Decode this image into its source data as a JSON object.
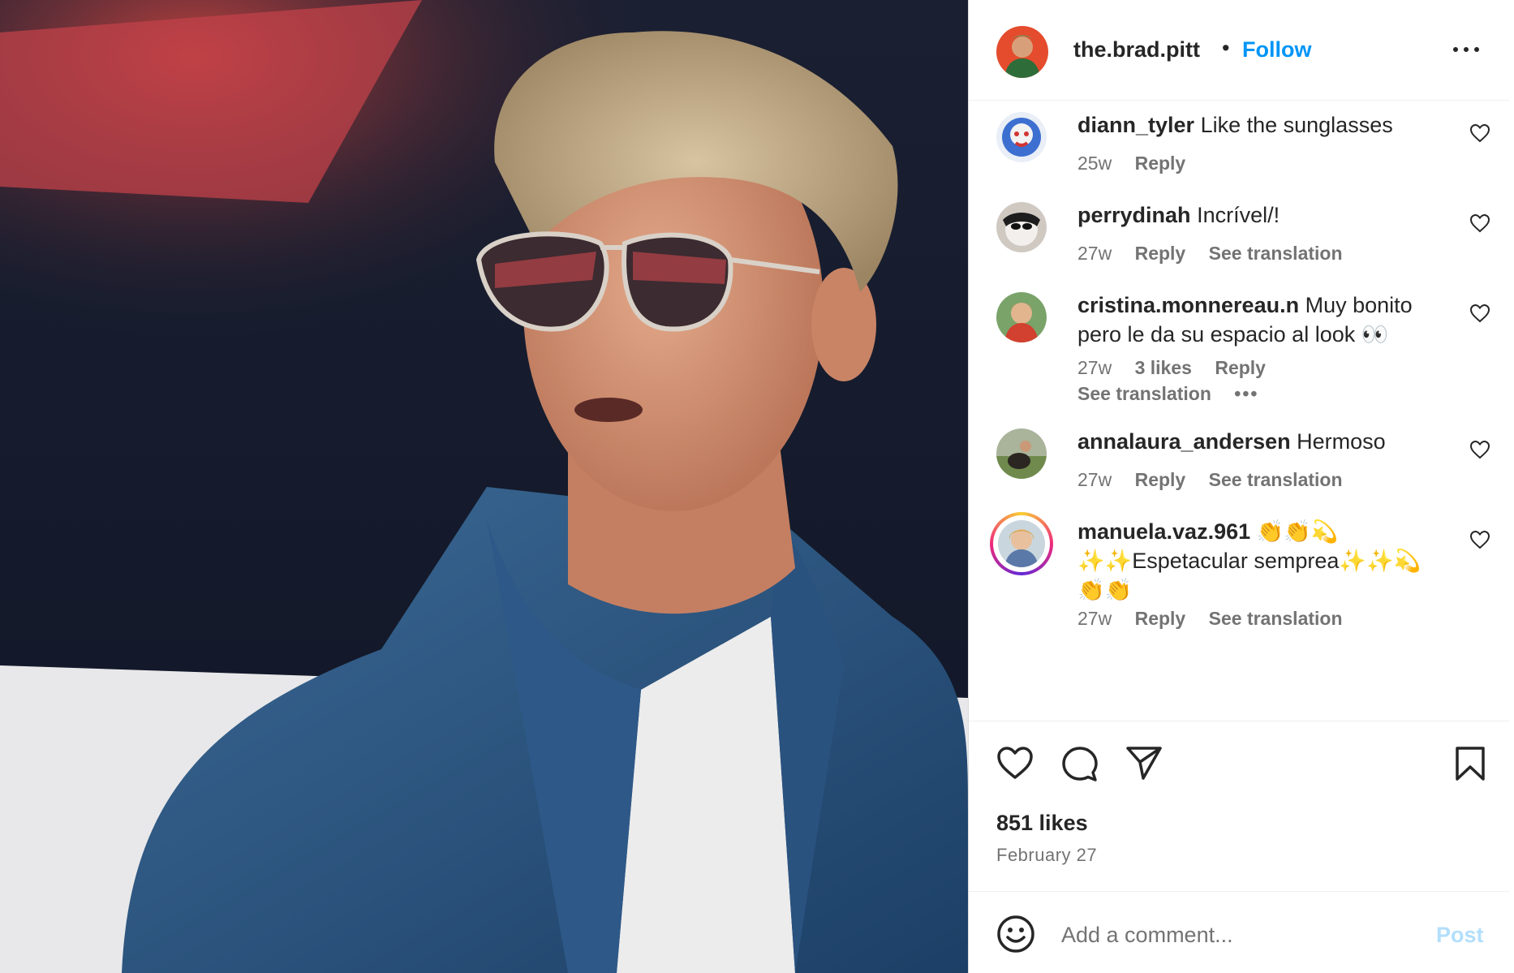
{
  "post": {
    "photo_alt": "photo",
    "author": "the.brad.pitt",
    "separator": "•",
    "follow_label": "Follow",
    "more_icon": "more-horizontal-icon"
  },
  "comments": [
    {
      "user": "diann_tyler",
      "text": "Like the sunglasses",
      "time": "25w",
      "likes": "",
      "reply": "Reply",
      "translation": "",
      "has_story_ring": false
    },
    {
      "user": "perrydinah",
      "text": "Incrível/!",
      "time": "27w",
      "likes": "",
      "reply": "Reply",
      "translation": "See translation",
      "has_story_ring": false
    },
    {
      "user": "cristina.monnereau.n",
      "text": "Muy bonito pero le da su espacio al look 👀",
      "time": "27w",
      "likes": "3 likes",
      "reply": "Reply",
      "translation": "See translation",
      "more": "•••",
      "has_story_ring": false
    },
    {
      "user": "annalaura_andersen",
      "text": "Hermoso",
      "time": "27w",
      "likes": "",
      "reply": "Reply",
      "translation": "See translation",
      "has_story_ring": false
    },
    {
      "user": "manuela.vaz.961",
      "text": "👏👏💫✨✨Espetacular semprea✨✨💫👏👏",
      "time": "27w",
      "likes": "",
      "reply": "Reply",
      "translation": "See translation",
      "has_story_ring": true
    }
  ],
  "actions": {
    "like_icon": "heart-icon",
    "comment_icon": "comment-icon",
    "share_icon": "paper-plane-icon",
    "save_icon": "bookmark-icon"
  },
  "likes_count": "851 likes",
  "date": "February 27",
  "composer": {
    "placeholder": "Add a comment...",
    "post_label": "Post"
  },
  "colors": {
    "follow": "#0095f6",
    "post_disabled": "#b2dffc",
    "muted_text": "#737373"
  }
}
